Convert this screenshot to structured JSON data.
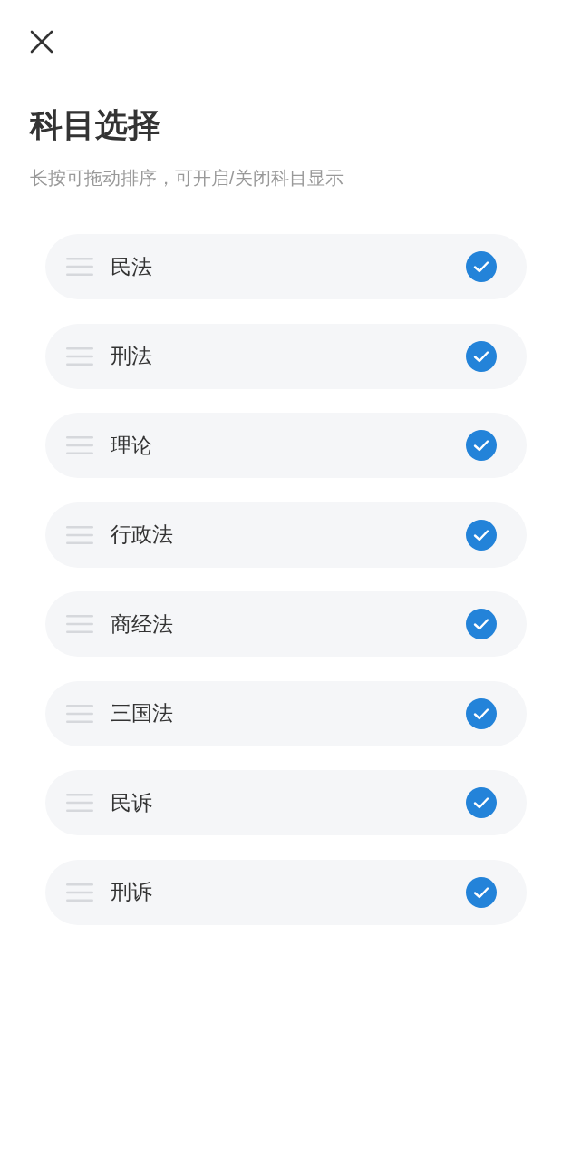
{
  "title": "科目选择",
  "subtitle": "长按可拖动排序，可开启/关闭科目显示",
  "subjects": [
    {
      "name": "民法",
      "checked": true
    },
    {
      "name": "刑法",
      "checked": true
    },
    {
      "name": "理论",
      "checked": true
    },
    {
      "name": "行政法",
      "checked": true
    },
    {
      "name": "商经法",
      "checked": true
    },
    {
      "name": "三国法",
      "checked": true
    },
    {
      "name": "民诉",
      "checked": true
    },
    {
      "name": "刑诉",
      "checked": true
    }
  ]
}
